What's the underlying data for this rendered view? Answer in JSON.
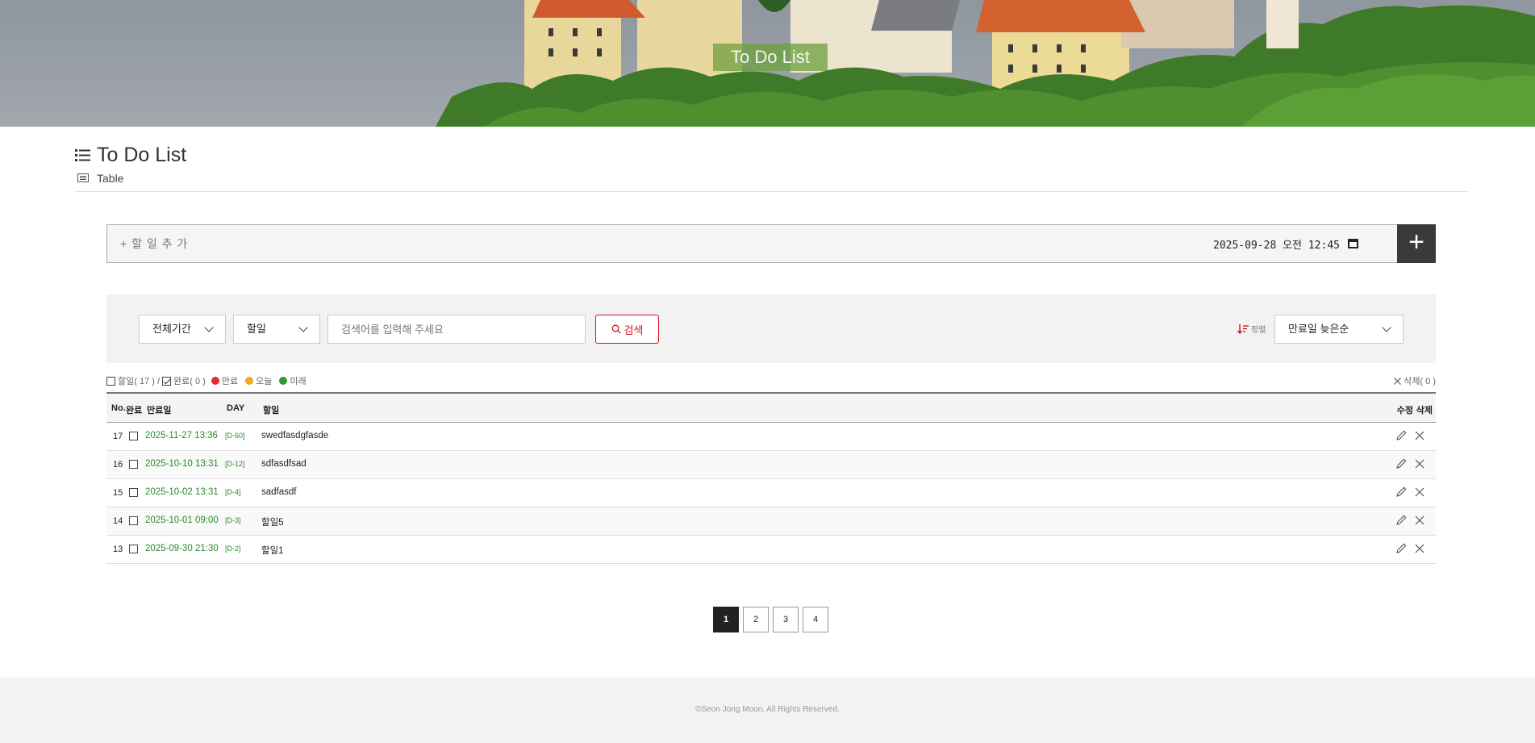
{
  "hero": {
    "title": "To Do List"
  },
  "page": {
    "title": "To Do List",
    "subtitle": "Table"
  },
  "add": {
    "placeholder": "+ 할 일 추 가",
    "datetime": "2025-09-28 오전 12:45",
    "add_label": "+"
  },
  "filter": {
    "period": "전체기간",
    "field": "할일",
    "search_placeholder": "검색어를 입력해 주세요",
    "search_label": "검색",
    "sort_label": "정렬",
    "sort_value": "만료일 늦은순"
  },
  "legend": {
    "todo": "할일( 17 ) /",
    "done": "완료( 0 )",
    "expired": "만료",
    "today": "오늘",
    "future": "미래",
    "delete": "삭제( 0 )",
    "colors": {
      "expired": "#d9342b",
      "today": "#f5a623",
      "future": "#2e9a3a"
    }
  },
  "table": {
    "headers": {
      "no": "No.",
      "done": "완료",
      "due": "만료일",
      "day": "DAY",
      "task": "할일",
      "edit": "수정",
      "delete": "삭제"
    },
    "rows": [
      {
        "no": "17",
        "due": "2025-11-27 13:36",
        "day": "[D-60]",
        "task": "swedfasdgfasde"
      },
      {
        "no": "16",
        "due": "2025-10-10 13:31",
        "day": "[D-12]",
        "task": "sdfasdfsad"
      },
      {
        "no": "15",
        "due": "2025-10-02 13:31",
        "day": "[D-4]",
        "task": "sadfasdf"
      },
      {
        "no": "14",
        "due": "2025-10-01 09:00",
        "day": "[D-3]",
        "task": "할일5"
      },
      {
        "no": "13",
        "due": "2025-09-30 21:30",
        "day": "[D-2]",
        "task": "할일1"
      }
    ]
  },
  "pagination": {
    "pages": [
      "1",
      "2",
      "3",
      "4"
    ],
    "current": "1"
  },
  "footer": {
    "copyright": "©Seon Jong Moon. All Rights Reserved."
  },
  "colors": {
    "accent_red": "#d8101a",
    "due_green": "#2c8a2a",
    "dark_button": "#3a3a3a"
  }
}
